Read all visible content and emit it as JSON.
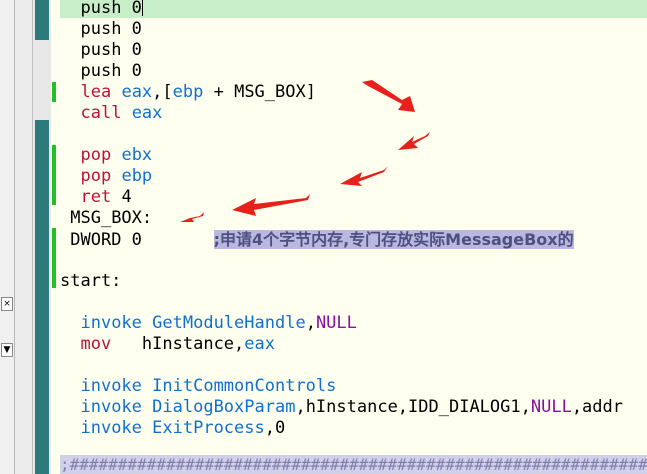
{
  "left_panel": {
    "close_glyph": "×",
    "dropdown_glyph": "▼"
  },
  "code": {
    "line1": "push 0",
    "line2": "push 0",
    "line3": "push 0",
    "line4": "push 0",
    "line5_kw": "lea",
    "line5_reg": "eax",
    "line5_rest_a": ",[",
    "line5_reg2": "ebp",
    "line5_rest_b": " + MSG_BOX]",
    "line6_kw": "call",
    "line6_reg": "eax",
    "line7_kw": "pop",
    "line7_reg": "ebx",
    "line8_kw": "pop",
    "line8_reg": "ebp",
    "line9_kw": "ret",
    "line9_val": "4",
    "line10": "MSG_BOX:",
    "line11": "DWORD 0",
    "line11_comment": ";申请4个字节内存,专门存放实际MessageBox的",
    "line12": "start:",
    "line13_kw": "invoke",
    "line13_fn": "GetModuleHandle",
    "line13_sep": ",",
    "line13_arg": "NULL",
    "line14_kw": "mov",
    "line14_var": "hInstance",
    "line14_sep": ",",
    "line14_reg": "eax",
    "line15_kw": "invoke",
    "line15_fn": "InitCommonControls",
    "line16_kw": "invoke",
    "line16_fn": "DialogBoxParam",
    "line16_args_a": ",hInstance,IDD_DIALOG1,",
    "line16_null": "NULL",
    "line16_args_b": ",addr",
    "line17_kw": "invoke",
    "line17_fn": "ExitProcess",
    "line17_args": ",0",
    "bottom": ";##################################################################"
  },
  "colors": {
    "highlight": "#c8eec8",
    "marker": "#22c022",
    "arrow": "#e8201c"
  }
}
